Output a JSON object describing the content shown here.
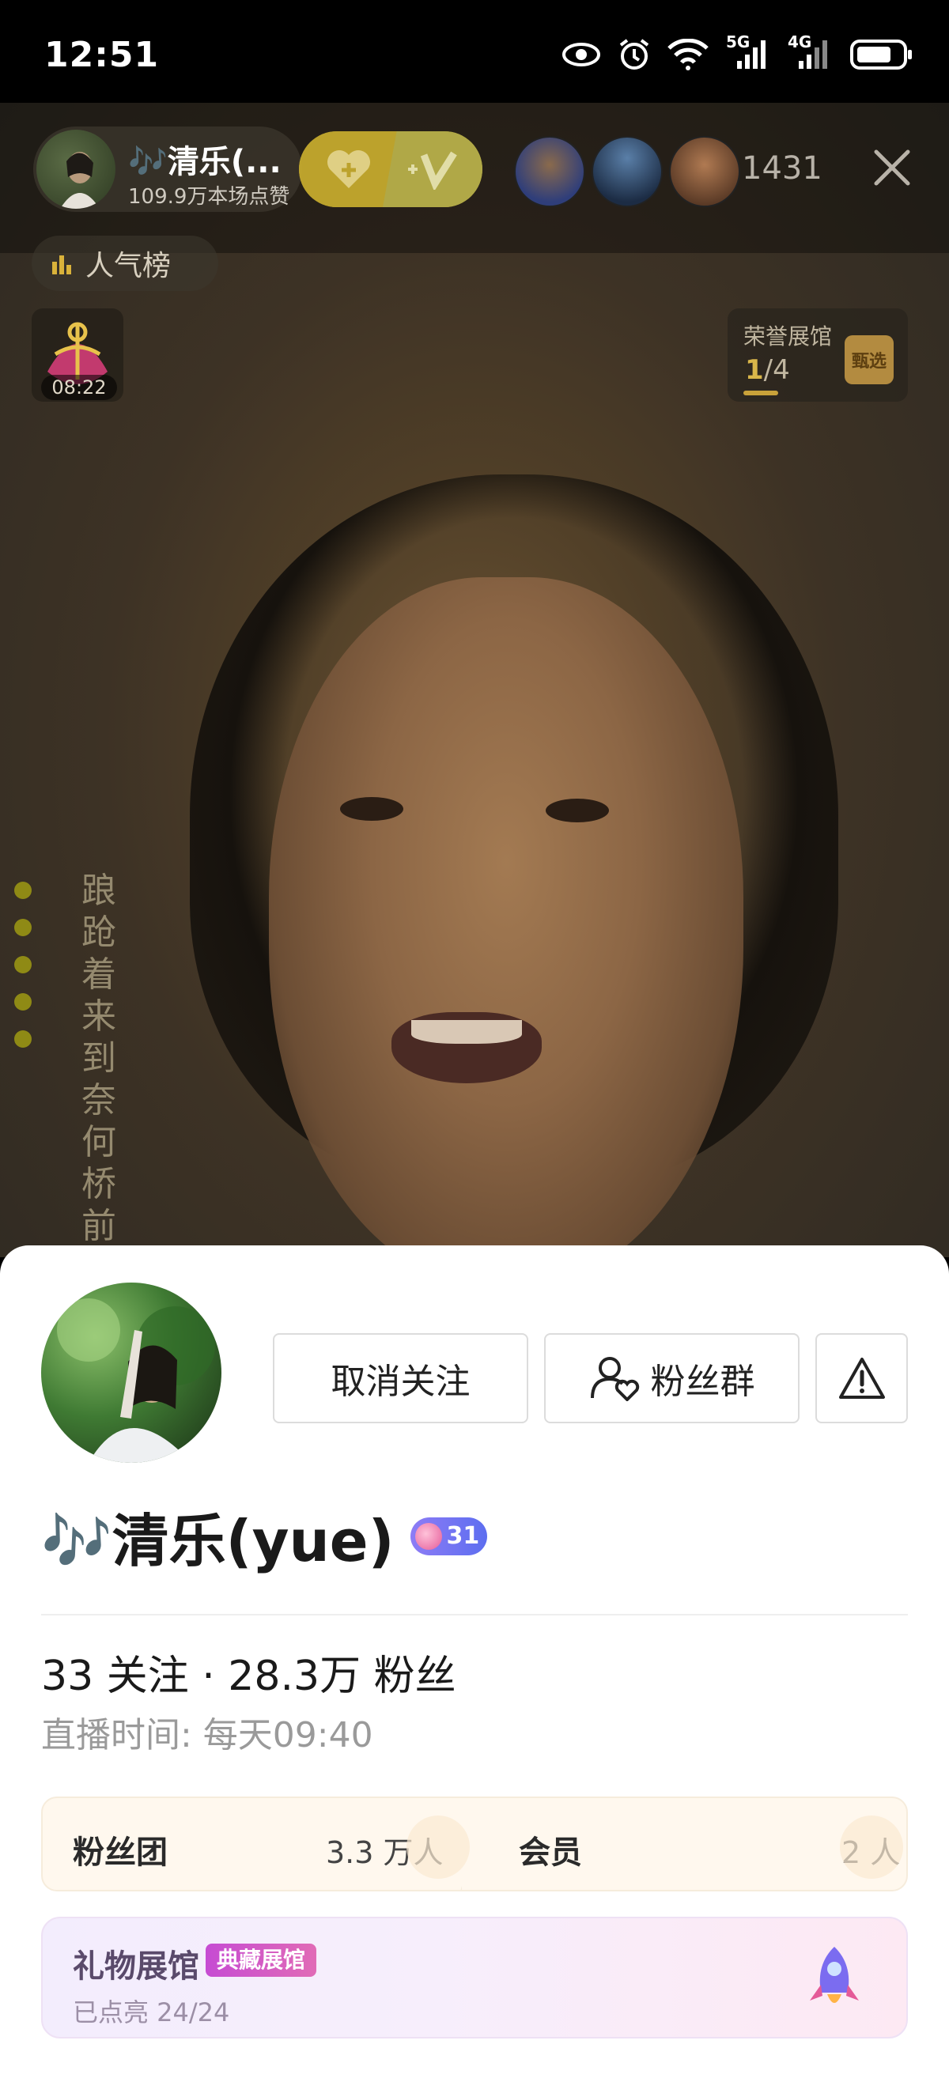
{
  "status_bar": {
    "time": "12:51",
    "network_5g": "5G",
    "network_4g": "4G"
  },
  "live": {
    "host_name": "🎶清乐(...",
    "host_likes": "109.9万本场点赞",
    "viewer_count": "1431",
    "rank_label": "人气榜",
    "gift_timer": "08:22",
    "honor_title": "荣誉展馆",
    "honor_current": "1",
    "honor_total": "/4",
    "honor_badge": "甄选",
    "lyrics": "踉跄着来到奈何桥前"
  },
  "profile": {
    "unfollow_label": "取消关注",
    "fan_group_label": "粉丝群",
    "name": "清乐(yue)",
    "name_prefix": "🎶",
    "level": "31",
    "stats": "33 关注 · 28.3万 粉丝",
    "live_time": "直播时间: 每天09:40",
    "fan_club_label": "粉丝团",
    "fan_club_value": "3.3 万人",
    "member_label": "会员",
    "member_value": "2 人",
    "museum_title": "礼物展馆",
    "museum_tag": "典藏展馆",
    "museum_sub": "已点亮  24/24"
  },
  "colors": {
    "accent_gold": "#c5aa2e",
    "level_badge": "#7a74f2",
    "museum_tag": "#d35bc6"
  }
}
